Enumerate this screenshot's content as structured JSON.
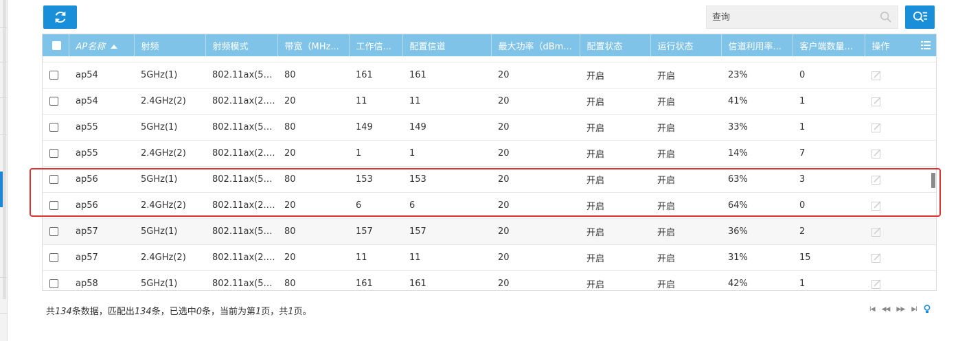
{
  "toolbar": {
    "search_placeholder": "查询"
  },
  "table": {
    "headers": [
      "AP名称",
      "射频",
      "射频模式",
      "带宽（MHz...",
      "工作信...",
      "配置信道",
      "最大功率（dBm...",
      "配置状态",
      "运行状态",
      "信道利用率...",
      "客户端数量...",
      "操作"
    ],
    "rows": [
      [
        "ap54",
        "5GHz(1)",
        "802.11ax(5G...",
        "80",
        "161",
        "161",
        "20",
        "开启",
        "开启",
        "23%",
        "0"
      ],
      [
        "ap54",
        "2.4GHz(2)",
        "802.11ax(2.4...",
        "20",
        "11",
        "11",
        "20",
        "开启",
        "开启",
        "41%",
        "1"
      ],
      [
        "ap55",
        "5GHz(1)",
        "802.11ax(5G...",
        "80",
        "149",
        "149",
        "20",
        "开启",
        "开启",
        "33%",
        "1"
      ],
      [
        "ap55",
        "2.4GHz(2)",
        "802.11ax(2.4...",
        "20",
        "1",
        "1",
        "20",
        "开启",
        "开启",
        "14%",
        "7"
      ],
      [
        "ap56",
        "5GHz(1)",
        "802.11ax(5G...",
        "80",
        "153",
        "153",
        "20",
        "开启",
        "开启",
        "63%",
        "3"
      ],
      [
        "ap56",
        "2.4GHz(2)",
        "802.11ax(2.4...",
        "20",
        "6",
        "6",
        "20",
        "开启",
        "开启",
        "64%",
        "0"
      ],
      [
        "ap57",
        "5GHz(1)",
        "802.11ax(5G...",
        "80",
        "157",
        "157",
        "20",
        "开启",
        "开启",
        "36%",
        "2"
      ],
      [
        "ap57",
        "2.4GHz(2)",
        "802.11ax(2.4...",
        "20",
        "11",
        "11",
        "20",
        "开启",
        "开启",
        "31%",
        "15"
      ],
      [
        "ap58",
        "5GHz(1)",
        "802.11ax(5G...",
        "80",
        "161",
        "161",
        "20",
        "开启",
        "开启",
        "42%",
        "1"
      ]
    ]
  },
  "footer": {
    "p1": "共",
    "total": "134",
    "p2": "条数据，匹配出",
    "matched": "134",
    "p3": "条，已选中",
    "selected": "0",
    "p4": "条，当前为第",
    "page": "1",
    "p5": "页，共",
    "pages": "1",
    "p6": "页。"
  },
  "colors": {
    "accent": "#1a8fd9",
    "header_bg": "#7fc3e8",
    "highlight": "#e03030"
  }
}
